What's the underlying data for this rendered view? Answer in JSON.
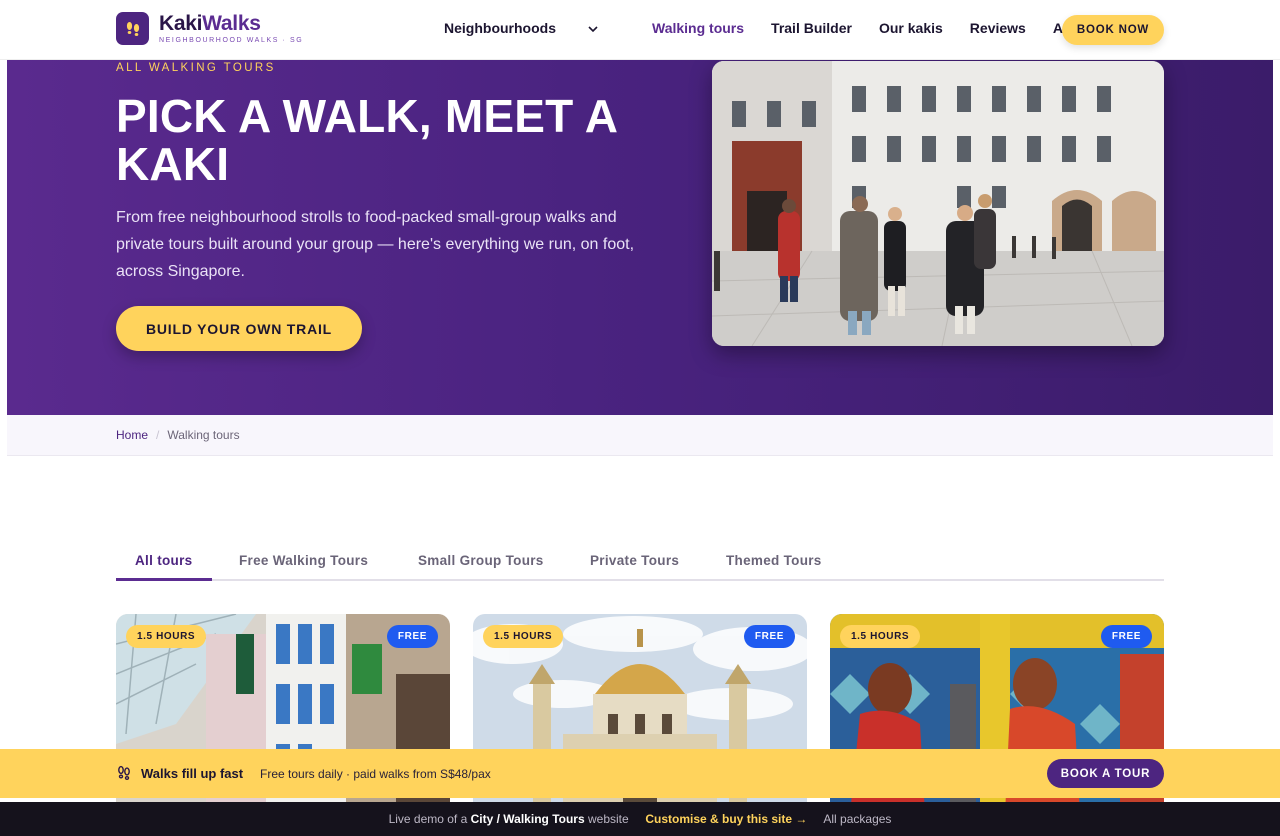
{
  "header": {
    "brand": {
      "name_a": "Kaki",
      "name_b": "Walks",
      "tagline": "NEIGHBOURHOOD WALKS · SG",
      "logo_icon": "footprints-icon"
    },
    "nav": [
      {
        "label": "Neighbourhoods",
        "dropdown": true
      },
      {
        "label": "Walking tours",
        "active": true
      },
      {
        "label": "Trail Builder"
      },
      {
        "label": "Our kakis"
      },
      {
        "label": "Reviews"
      },
      {
        "label": "About"
      }
    ],
    "book_now": "BOOK NOW"
  },
  "hero": {
    "eyebrow": "ALL WALKING TOURS",
    "title": "PICK A WALK, MEET A KAKI",
    "description": "From free neighbourhood strolls to food-packed small-group walks and private tours built around your group — here's everything we run, on foot, across Singapore.",
    "cta": "BUILD YOUR OWN TRAIL"
  },
  "breadcrumb": {
    "home": "Home",
    "sep": "/",
    "current": "Walking tours"
  },
  "tabs": [
    {
      "label": "All tours",
      "active": true
    },
    {
      "label": "Free Walking Tours"
    },
    {
      "label": "Small Group Tours"
    },
    {
      "label": "Private Tours"
    },
    {
      "label": "Themed Tours"
    }
  ],
  "cards": [
    {
      "duration": "1.5 HOURS",
      "badge": "FREE"
    },
    {
      "duration": "1.5 HOURS",
      "badge": "FREE"
    },
    {
      "duration": "1.5 HOURS",
      "badge": "FREE"
    }
  ],
  "sticky": {
    "title": "Walks fill up fast",
    "subtitle": "Free tours daily · paid walks from S$48/pax",
    "button": "BOOK A TOUR"
  },
  "demo_bar": {
    "prefix": "Live demo of a",
    "site_type": "City / Walking Tours",
    "suffix": "website",
    "customise": "Customise & buy this site →",
    "packages": "All packages"
  },
  "colors": {
    "brand_purple": "#4d2580",
    "accent_yellow": "#ffd35c",
    "free_blue": "#1f5bf0"
  }
}
